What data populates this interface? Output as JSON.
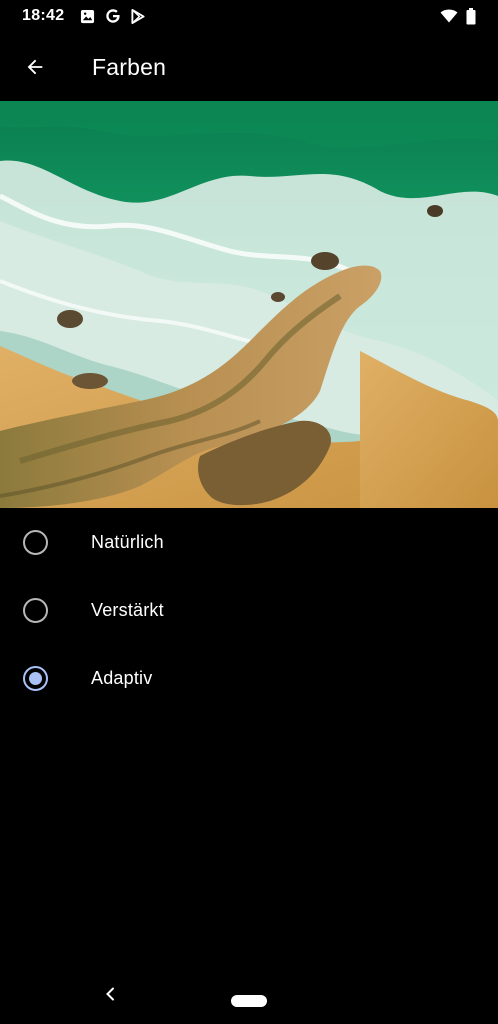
{
  "status_bar": {
    "time": "18:42",
    "left_icons": [
      "image-icon",
      "google-icon",
      "play-store-icon"
    ],
    "right_icons": [
      "wifi-icon",
      "battery-icon"
    ]
  },
  "app_bar": {
    "back_icon": "arrow-left-icon",
    "title": "Farben"
  },
  "preview": {
    "description_colors": {
      "sea": "#0f9a63",
      "sand": "#d4a050",
      "rock": "#b88a45"
    }
  },
  "options": [
    {
      "label": "Natürlich",
      "selected": false
    },
    {
      "label": "Verstärkt",
      "selected": false
    },
    {
      "label": "Adaptiv",
      "selected": true
    }
  ],
  "colors": {
    "accent": "#a9c1f5",
    "radio_unselected": "#b7b7b7",
    "background": "#000000",
    "text": "#ffffff"
  },
  "nav_bar": {
    "icons": [
      "nav-back-icon",
      "nav-home-pill"
    ]
  }
}
